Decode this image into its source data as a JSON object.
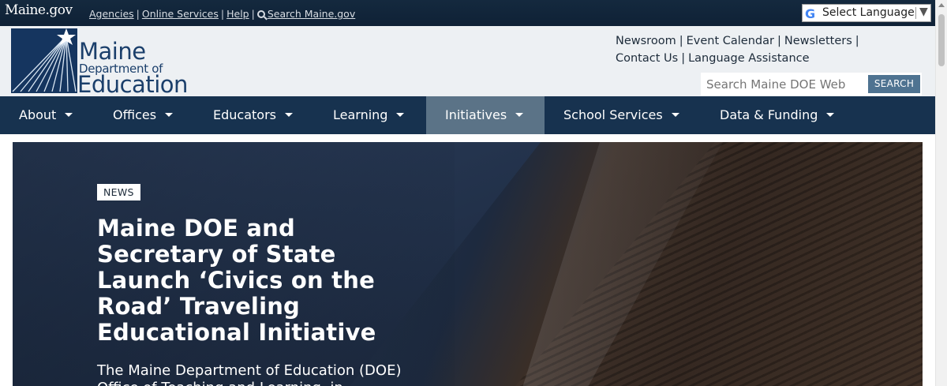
{
  "statebar": {
    "brand": "Maine.gov",
    "links": [
      "Agencies",
      "Online Services",
      "Help"
    ],
    "search_link": "Search Maine.gov",
    "translate": {
      "label": "Select Language",
      "arrow": "▼",
      "icon": "google-g-icon"
    }
  },
  "header": {
    "logo": {
      "line1": "Maine",
      "line2": "Department of",
      "line3": "Education"
    },
    "utility_links": [
      "Newsroom",
      "Event Calendar",
      "Newsletters",
      "Contact Us",
      "Language Assistance"
    ],
    "search": {
      "placeholder": "Search Maine DOE Web",
      "button": "SEARCH"
    }
  },
  "nav": {
    "items": [
      {
        "label": "About"
      },
      {
        "label": "Offices"
      },
      {
        "label": "Educators"
      },
      {
        "label": "Learning"
      },
      {
        "label": "Initiatives",
        "active": true
      },
      {
        "label": "School Services"
      },
      {
        "label": "Data & Funding"
      }
    ]
  },
  "hero": {
    "tag": "NEWS",
    "headline": "Maine DOE and Secretary of State Launch ‘Civics on the Road’ Traveling Educational Initiative",
    "summary": "The Maine Department of Education (DOE) Office of Teaching and Learning, in"
  },
  "colors": {
    "nav_bg": "#17324f",
    "nav_active": "#5b7387",
    "brand_blue": "#1b3f6b",
    "search_btn": "#4f7391"
  }
}
